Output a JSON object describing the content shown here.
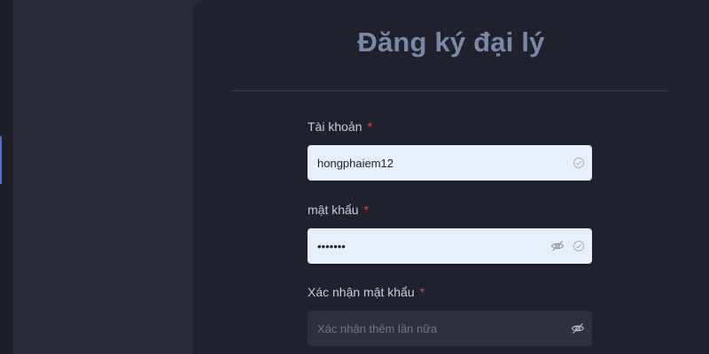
{
  "form": {
    "title": "Đăng ký đại lý",
    "required_mark": "*",
    "username": {
      "label": "Tài khoản",
      "value": "hongphaiem12"
    },
    "password": {
      "label": "mật khẩu",
      "value": "•••••••"
    },
    "confirm_password": {
      "label": "Xác nhận mật khẩu",
      "value": "",
      "placeholder": "Xác nhận thêm lần nữa"
    }
  },
  "icons": {
    "valid": "check-circle-icon",
    "toggle_visibility": "eye-off-icon"
  },
  "colors": {
    "accent": "#4f6fe0",
    "required": "#e2474b",
    "title": "#7b89a8",
    "filled_input_bg": "#e8effc"
  }
}
